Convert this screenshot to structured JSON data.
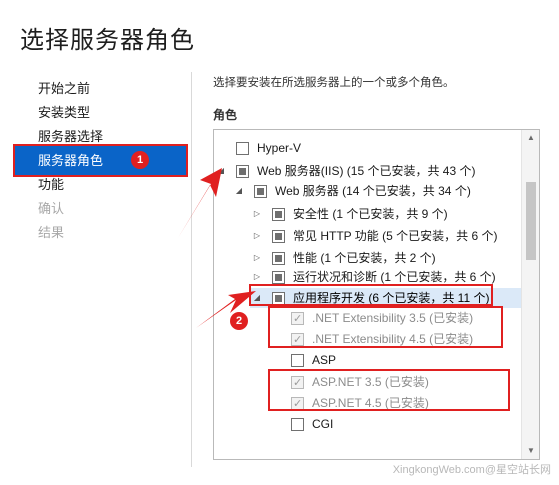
{
  "page": {
    "title": "选择服务器角色"
  },
  "nav": {
    "items": [
      {
        "label": "开始之前"
      },
      {
        "label": "安装类型"
      },
      {
        "label": "服务器选择"
      },
      {
        "label": "服务器角色"
      },
      {
        "label": "功能"
      },
      {
        "label": "确认"
      },
      {
        "label": "结果"
      }
    ]
  },
  "main": {
    "description": "选择要安装在所选服务器上的一个或多个角色。",
    "roles_label": "角色"
  },
  "tree": [
    {
      "label": "Hyper-V"
    },
    {
      "label": "Web 服务器(IIS) (15 个已安装，共 43 个)"
    },
    {
      "label": "Web 服务器 (14 个已安装，共 34 个)"
    },
    {
      "label": "安全性 (1 个已安装，共 9 个)"
    },
    {
      "label": "常见 HTTP 功能 (5 个已安装，共 6 个)"
    },
    {
      "label": "性能 (1 个已安装，共 2 个)"
    },
    {
      "label": "运行状况和诊断 (1 个已安装，共 6 个)"
    },
    {
      "label": "应用程序开发 (6 个已安装，共 11 个)"
    },
    {
      "label": ".NET Extensibility 3.5 (已安装)"
    },
    {
      "label": ".NET Extensibility 4.5 (已安装)"
    },
    {
      "label": "ASP"
    },
    {
      "label": "ASP.NET 3.5 (已安装)"
    },
    {
      "label": "ASP.NET 4.5 (已安装)"
    },
    {
      "label": "CGI"
    }
  ],
  "annotations": {
    "badge1": "1",
    "badge2": "2"
  },
  "watermark": "XingkongWeb.com@星空站长网",
  "colors": {
    "accent": "#0a64c8",
    "highlight": "#e02020",
    "selected_row": "#dbe9f8"
  }
}
